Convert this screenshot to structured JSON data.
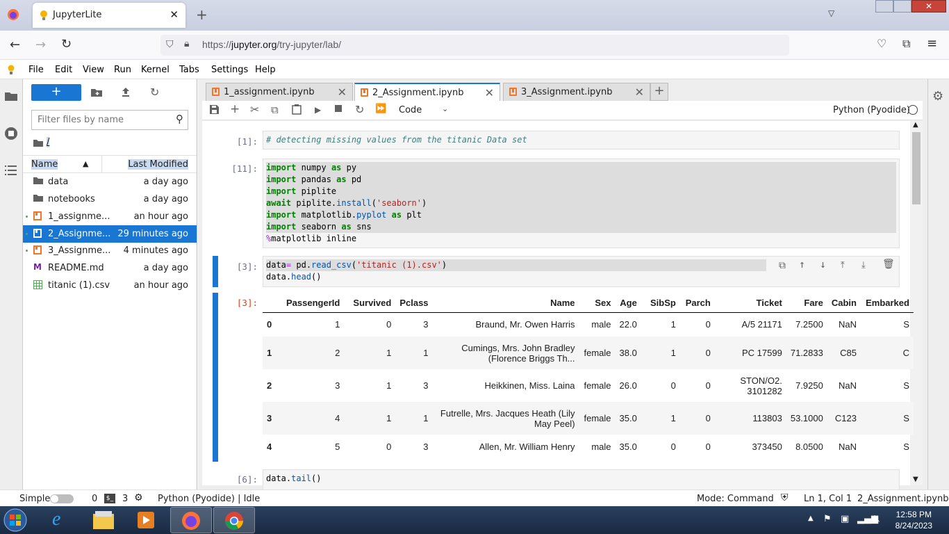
{
  "browser": {
    "tab_title": "JupyterLite",
    "url_prefix": "https://",
    "url_domain": "jupyter.org",
    "url_path": "/try-jupyter/lab/"
  },
  "menu": [
    "File",
    "Edit",
    "View",
    "Run",
    "Kernel",
    "Tabs",
    "Settings",
    "Help"
  ],
  "file_browser": {
    "filter_placeholder": "Filter files by name",
    "path": "/",
    "col_name": "Name",
    "col_modified": "Last Modified",
    "items": [
      {
        "name": "data",
        "modified": "a day ago",
        "type": "folder"
      },
      {
        "name": "notebooks",
        "modified": "a day ago",
        "type": "folder"
      },
      {
        "name": "1_assignme...",
        "modified": "an hour ago",
        "type": "notebook"
      },
      {
        "name": "2_Assignme...",
        "modified": "29 minutes ago",
        "type": "notebook"
      },
      {
        "name": "3_Assignme...",
        "modified": "4 minutes ago",
        "type": "notebook"
      },
      {
        "name": "README.md",
        "modified": "a day ago",
        "type": "markdown"
      },
      {
        "name": "titanic (1).csv",
        "modified": "an hour ago",
        "type": "csv"
      }
    ]
  },
  "notebook_tabs": [
    "1_assignment.ipynb",
    "2_Assignment.ipynb",
    "3_Assignment.ipynb"
  ],
  "toolbar": {
    "cell_type": "Code",
    "kernel": "Python (Pyodide)"
  },
  "cells": {
    "c1_prompt": "[1]:",
    "c1_comment": "# detecting missing values from the titanic Data set",
    "c2_prompt": "[11]:",
    "c3_prompt": "[3]:",
    "c3_out_prompt": "[3]:",
    "c4_prompt": "[6]:"
  },
  "dataframe": {
    "columns": [
      "",
      "PassengerId",
      "Survived",
      "Pclass",
      "Name",
      "Sex",
      "Age",
      "SibSp",
      "Parch",
      "Ticket",
      "Fare",
      "Cabin",
      "Embarked"
    ],
    "rows": [
      [
        "0",
        "1",
        "0",
        "3",
        "Braund, Mr. Owen Harris",
        "male",
        "22.0",
        "1",
        "0",
        "A/5 21171",
        "7.2500",
        "NaN",
        "S"
      ],
      [
        "1",
        "2",
        "1",
        "1",
        "Cumings, Mrs. John Bradley (Florence Briggs Th...",
        "female",
        "38.0",
        "1",
        "0",
        "PC 17599",
        "71.2833",
        "C85",
        "C"
      ],
      [
        "2",
        "3",
        "1",
        "3",
        "Heikkinen, Miss. Laina",
        "female",
        "26.0",
        "0",
        "0",
        "STON/O2. 3101282",
        "7.9250",
        "NaN",
        "S"
      ],
      [
        "3",
        "4",
        "1",
        "1",
        "Futrelle, Mrs. Jacques Heath (Lily May Peel)",
        "female",
        "35.0",
        "1",
        "0",
        "113803",
        "53.1000",
        "C123",
        "S"
      ],
      [
        "4",
        "5",
        "0",
        "3",
        "Allen, Mr. William Henry",
        "male",
        "35.0",
        "0",
        "0",
        "373450",
        "8.0500",
        "NaN",
        "S"
      ]
    ]
  },
  "statusbar": {
    "mode_label": "Simple",
    "terminals": "0",
    "kernels": "3",
    "kernel_status": "Python (Pyodide) | Idle",
    "mode": "Mode: Command",
    "position": "Ln 1, Col 1",
    "file": "2_Assignment.ipynb"
  },
  "clock": {
    "time": "12:58 PM",
    "date": "8/24/2023"
  },
  "colors": {
    "accent": "#1976d2",
    "notebook_orange": "#f37626"
  }
}
